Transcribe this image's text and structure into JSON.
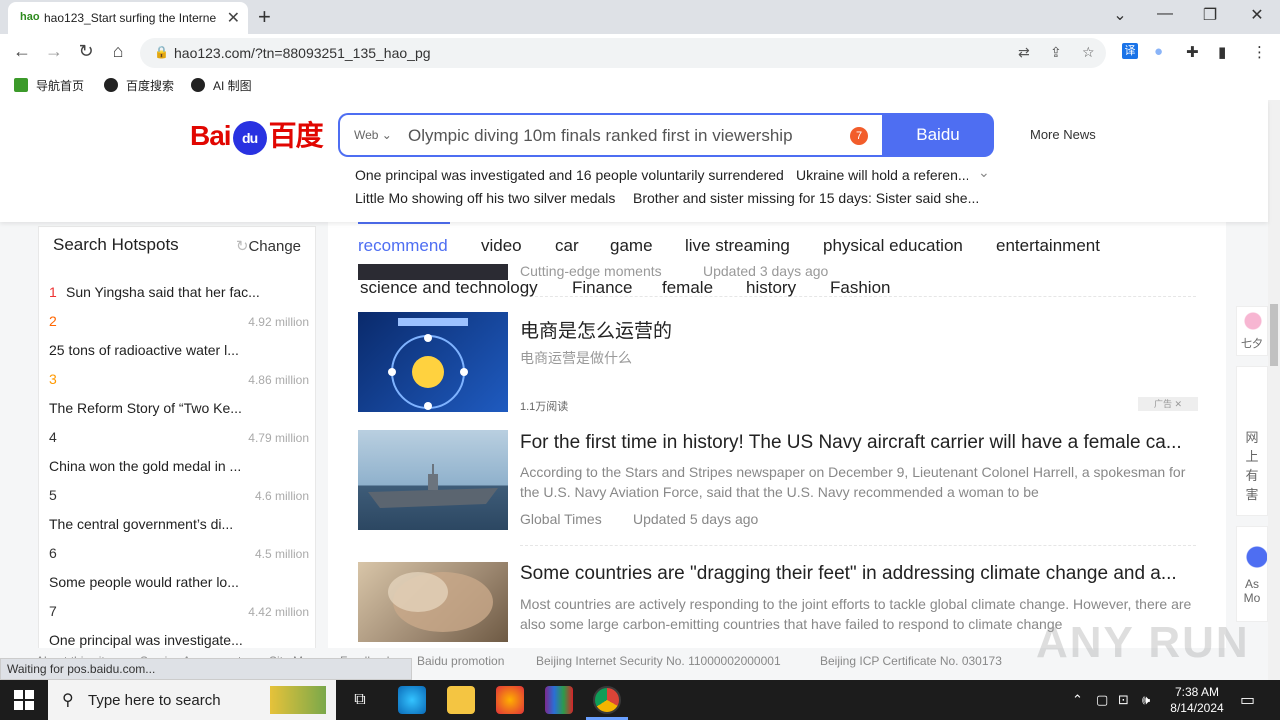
{
  "browser": {
    "tab_title": "hao123_Start surfing the Internet",
    "url": "hao123.com/?tn=88093251_135_hao_pg",
    "bookmarks": [
      "导航首页",
      "百度搜索",
      "AI 制图"
    ]
  },
  "header": {
    "logo_text_left": "Bai",
    "logo_paw": "du",
    "logo_text_right": "百度",
    "search_type": "Web",
    "search_hint": "Olympic diving 10m finals ranked first in viewership",
    "search_badge": "7",
    "search_button": "Baidu",
    "more_news": "More News",
    "hot_links": [
      "One principal was investigated and 16 people voluntarily surrendered",
      "Ukraine will hold a referen...",
      "Little Mo showing off his two silver medals",
      "Brother and sister missing for 15 days: Sister said she..."
    ]
  },
  "hotspots": {
    "title": "Search Hotspots",
    "change": "Change",
    "items": [
      {
        "rank": "1",
        "title": "Sun Yingsha said that her fac...",
        "count": ""
      },
      {
        "rank": "2",
        "title": "25 tons of radioactive water l...",
        "count": "4.92 million"
      },
      {
        "rank": "3",
        "title": "The Reform Story of “Two Ke...",
        "count": "4.86 million"
      },
      {
        "rank": "4",
        "title": "China won the gold medal in ...",
        "count": "4.79 million"
      },
      {
        "rank": "5",
        "title": "The central government’s di...",
        "count": "4.6 million"
      },
      {
        "rank": "6",
        "title": "Some people would rather lo...",
        "count": "4.5 million"
      },
      {
        "rank": "7",
        "title": "One principal was investigate...",
        "count": "4.42 million"
      }
    ]
  },
  "feed": {
    "tabs_row1": [
      "recommend",
      "video",
      "car",
      "game",
      "live streaming",
      "physical education",
      "entertainment"
    ],
    "tabs_row2": [
      "science and technology",
      "Finance",
      "female",
      "history",
      "Fashion"
    ],
    "prev_meta_source": "Cutting-edge moments",
    "prev_meta_time": "Updated 3 days ago",
    "articles": [
      {
        "title": "电商是怎么运营的",
        "desc": "电商运营是做什么",
        "source": "1.1万阅读",
        "time": "",
        "ad": "广告"
      },
      {
        "title": "For the first time in history! The US Navy aircraft carrier will have a female ca...",
        "desc": "According to the Stars and Stripes newspaper on December 9, Lieutenant Colonel Harrell, a spokesman for the U.S. Navy Aviation Force, said that the U.S. Navy recommended a woman to be",
        "source": "Global Times",
        "time": "Updated 5 days ago"
      },
      {
        "title": "Some countries are \"dragging their feet\" in addressing climate change and a...",
        "desc": "Most countries are actively responding to the joint efforts to tackle global climate change. However, there are also some large carbon-emitting countries that have failed to respond to climate change",
        "source": "",
        "time": ""
      }
    ]
  },
  "right_cards": [
    "七夕",
    "网上有害",
    "As Mo"
  ],
  "footer": {
    "links": [
      "About this site",
      "Service Agreement",
      "Site Map",
      "Feedback",
      "Baidu promotion",
      "Beijing Internet Security No. 11000002000001",
      "Beijing ICP Certificate No. 030173"
    ],
    "status": "Waiting for pos.baidu.com...",
    "watermark": "ANY RUN"
  },
  "taskbar": {
    "search_placeholder": "Type here to search",
    "time": "7:38 AM",
    "date": "8/14/2024"
  }
}
